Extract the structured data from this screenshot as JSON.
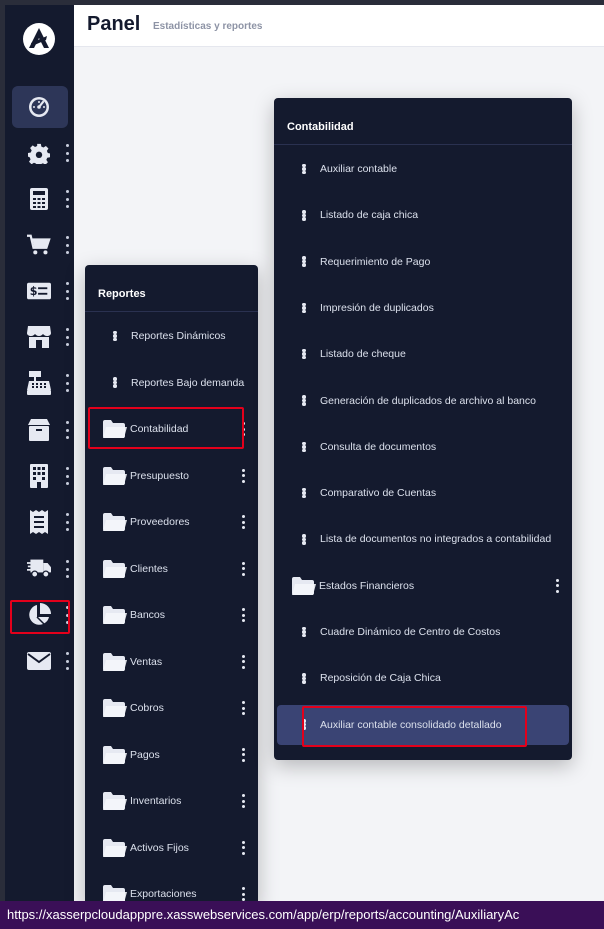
{
  "header": {
    "title": "Panel",
    "subtitle": "Estadísticas y reportes"
  },
  "sidebar": {
    "items": [
      {
        "icon": "dashboard-gauge-icon",
        "active": true
      },
      {
        "icon": "gear-icon"
      },
      {
        "icon": "calculator-icon"
      },
      {
        "icon": "cart-icon"
      },
      {
        "icon": "money-card-icon"
      },
      {
        "icon": "store-icon"
      },
      {
        "icon": "cash-register-icon"
      },
      {
        "icon": "box-icon"
      },
      {
        "icon": "building-icon"
      },
      {
        "icon": "receipt-icon"
      },
      {
        "icon": "truck-icon"
      },
      {
        "icon": "pie-chart-icon"
      },
      {
        "icon": "envelope-icon"
      }
    ]
  },
  "reportes": {
    "title": "Reportes",
    "items": [
      {
        "label": "Reportes Dinámicos",
        "kind": "dots"
      },
      {
        "label": "Reportes Bajo demanda",
        "kind": "dots"
      },
      {
        "label": "Contabilidad",
        "kind": "folder"
      },
      {
        "label": "Presupuesto",
        "kind": "folder"
      },
      {
        "label": "Proveedores",
        "kind": "folder"
      },
      {
        "label": "Clientes",
        "kind": "folder"
      },
      {
        "label": "Bancos",
        "kind": "folder"
      },
      {
        "label": "Ventas",
        "kind": "folder"
      },
      {
        "label": "Cobros",
        "kind": "folder"
      },
      {
        "label": "Pagos",
        "kind": "folder"
      },
      {
        "label": "Inventarios",
        "kind": "folder"
      },
      {
        "label": "Activos Fijos",
        "kind": "folder"
      },
      {
        "label": "Exportaciones",
        "kind": "folder"
      }
    ]
  },
  "contabilidad": {
    "title": "Contabilidad",
    "items": [
      {
        "label": "Auxiliar contable",
        "kind": "dots"
      },
      {
        "label": "Listado de caja chica",
        "kind": "dots"
      },
      {
        "label": "Requerimiento de Pago",
        "kind": "dots"
      },
      {
        "label": "Impresión de duplicados",
        "kind": "dots"
      },
      {
        "label": "Listado de cheque",
        "kind": "dots"
      },
      {
        "label": "Generación de duplicados de archivo al banco",
        "kind": "dots"
      },
      {
        "label": "Consulta de documentos",
        "kind": "dots"
      },
      {
        "label": "Comparativo de Cuentas",
        "kind": "dots"
      },
      {
        "label": "Lista de documentos no integrados a contabilidad",
        "kind": "dots"
      },
      {
        "label": "Estados Financieros",
        "kind": "folder"
      },
      {
        "label": "Cuadre Dinámico de Centro de Costos",
        "kind": "dots"
      },
      {
        "label": "Reposición de Caja Chica",
        "kind": "dots"
      },
      {
        "label": "Auxiliar contable consolidado detallado",
        "kind": "dots",
        "selected": true
      }
    ]
  },
  "status_url": "https://xasserpcloudapppre.xasswebservices.com/app/erp/reports/accounting/AuxiliaryAc",
  "colors": {
    "sidebar_bg": "#141a2e",
    "active_bg": "#2d3658",
    "highlight": "#e3001b",
    "statusbar": "#3a0f57"
  }
}
